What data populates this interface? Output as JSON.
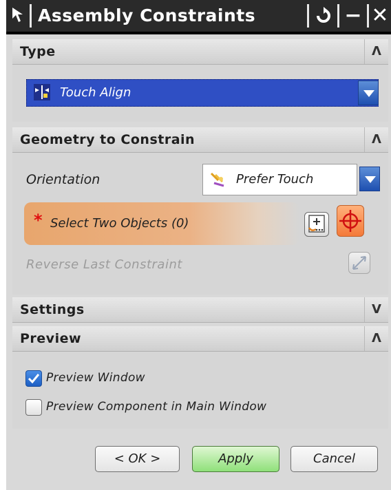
{
  "titlebar": {
    "title": "Assembly Constraints",
    "reset_icon": "reset-icon",
    "minimize_symbol": "−",
    "close_symbol": "✕"
  },
  "type_section": {
    "title": "Type",
    "toggle_symbol": "Λ",
    "selected_type": "Touch Align"
  },
  "geometry_section": {
    "title": "Geometry to Constrain",
    "toggle_symbol": "Λ",
    "orientation_label": "Orientation",
    "orientation_value": "Prefer Touch",
    "select_label": "Select Two Objects (0)",
    "required_marker": "*",
    "reverse_label": "Reverse Last Constraint"
  },
  "settings_section": {
    "title": "Settings",
    "toggle_symbol": "V"
  },
  "preview_section": {
    "title": "Preview",
    "toggle_symbol": "Λ",
    "options": [
      {
        "label": "Preview Window",
        "checked": true
      },
      {
        "label": "Preview Component in Main Window",
        "checked": false
      }
    ]
  },
  "buttons": {
    "ok": "< OK >",
    "apply": "Apply",
    "cancel": "Cancel"
  },
  "colors": {
    "accent": "#2f4fc4",
    "selection_highlight": "#e8a66d",
    "apply_green": "#8fe07a"
  }
}
